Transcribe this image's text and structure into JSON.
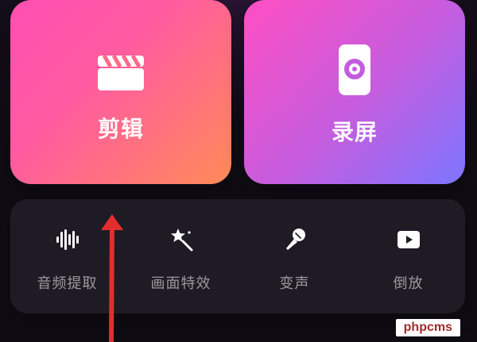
{
  "main_cards": {
    "edit": {
      "label": "剪辑",
      "icon": "clapperboard-icon"
    },
    "record": {
      "label": "录屏",
      "icon": "screen-record-icon"
    }
  },
  "tools": [
    {
      "label": "音频提取",
      "icon": "audio-waveform-icon"
    },
    {
      "label": "画面特效",
      "icon": "magic-wand-star-icon"
    },
    {
      "label": "变声",
      "icon": "microphone-icon"
    },
    {
      "label": "倒放",
      "icon": "play-button-icon"
    }
  ],
  "annotation": {
    "arrow_color": "#e32e2e"
  },
  "watermark": {
    "text": "phpcms"
  },
  "colors": {
    "edit_gradient": [
      "#ff4fb3",
      "#ff8b58"
    ],
    "record_gradient": [
      "#ff4fc3",
      "#7d76ff"
    ],
    "panel": "#1e1b24",
    "background": "#0e0c12"
  }
}
